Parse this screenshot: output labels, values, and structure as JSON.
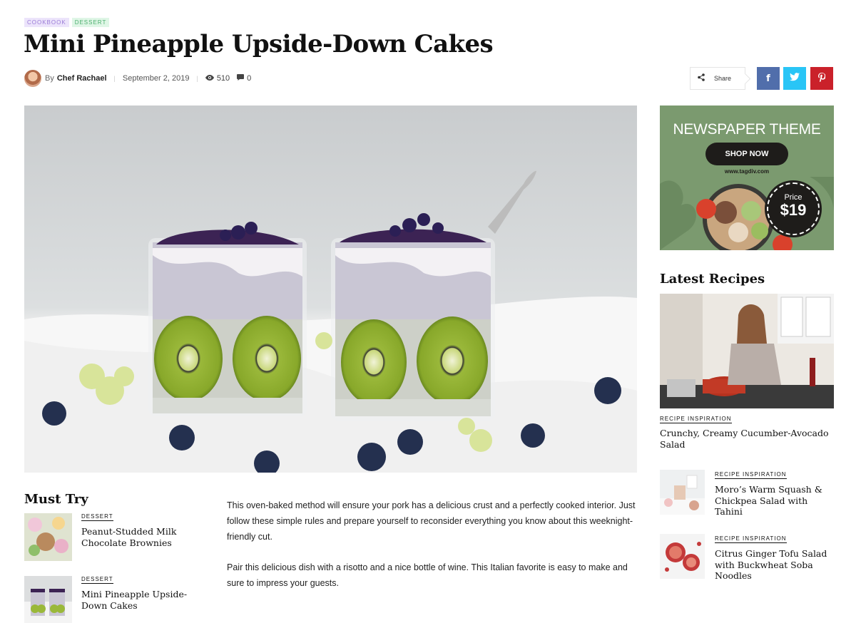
{
  "categories": [
    "COOKBOOK",
    "DESSERT"
  ],
  "title": "Mini Pineapple Upside-Down Cakes",
  "meta": {
    "by": "By",
    "author": "Chef Rachael",
    "date": "September 2, 2019",
    "views": "510",
    "comments": "0"
  },
  "share": {
    "label": "Share",
    "facebook": "f",
    "twitter": "t",
    "pinterest": "p"
  },
  "ad": {
    "title": "NEWSPAPER THEME",
    "button": "SHOP NOW",
    "url": "www.tagdiv.com",
    "price_label": "Price",
    "price_value": "$19"
  },
  "must_try": {
    "heading": "Must Try",
    "items": [
      {
        "category": "DESSERT",
        "title": "Peanut-Studded Milk Chocolate Brownies"
      },
      {
        "category": "DESSERT",
        "title": "Mini Pineapple Upside-Down Cakes"
      }
    ]
  },
  "body": {
    "paragraphs": [
      "This oven-baked method will ensure your pork has a delicious crust and a perfectly cooked interior. Just follow these simple rules and prepare yourself to reconsider everything you know about this weeknight-friendly cut.",
      "Pair this delicious dish with a risotto and a nice bottle of wine. This Italian favorite is easy to make and sure to impress your guests."
    ]
  },
  "latest": {
    "heading": "Latest Recipes",
    "featured": {
      "category": "RECIPE INSPIRATION",
      "title": "Crunchy, Creamy Cucumber-Avocado Salad"
    },
    "items": [
      {
        "category": "RECIPE INSPIRATION",
        "title": "Moro’s Warm Squash & Chickpea Salad with Tahini"
      },
      {
        "category": "RECIPE INSPIRATION",
        "title": "Citrus Ginger Tofu Salad with Buckwheat Soba Noodles"
      }
    ]
  }
}
